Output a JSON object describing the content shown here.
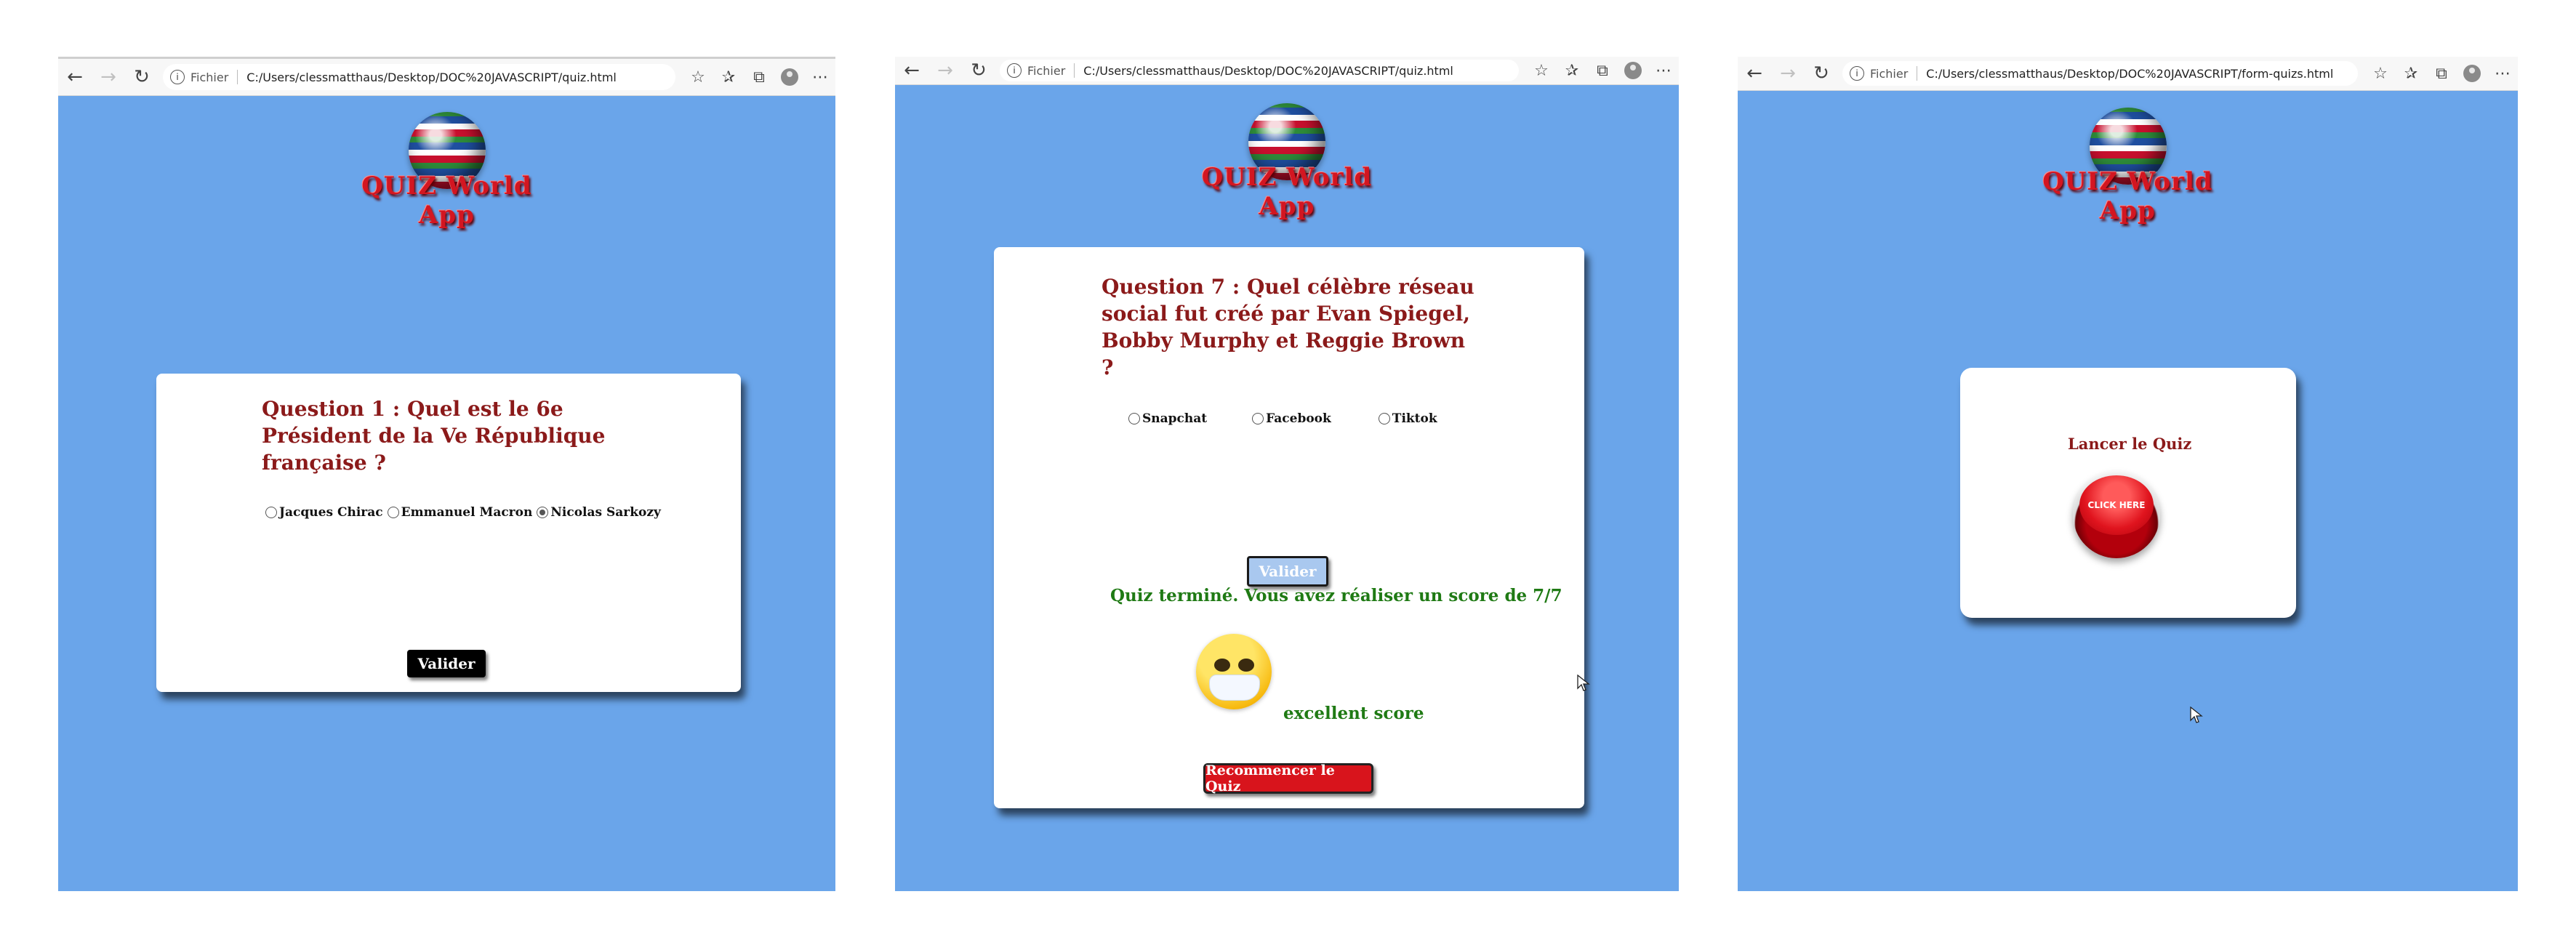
{
  "browser": {
    "file_label": "Fichier",
    "windows": [
      {
        "url": "C:/Users/clessmatthaus/Desktop/DOC%20JAVASCRIPT/quiz.html"
      },
      {
        "url": "C:/Users/clessmatthaus/Desktop/DOC%20JAVASCRIPT/quiz.html"
      },
      {
        "url": "C:/Users/clessmatthaus/Desktop/DOC%20JAVASCRIPT/form-quizs.html"
      }
    ]
  },
  "app": {
    "title": "QUIZ World App"
  },
  "screen1": {
    "question": "Question 1 : Quel est le 6e Président de la Ve République française ?",
    "options": [
      "Jacques Chirac",
      "Emmanuel Macron",
      "Nicolas Sarkozy"
    ],
    "selected_index": 2,
    "submit_label": "Valider"
  },
  "screen2": {
    "question": "Question 7 : Quel célèbre réseau social fut créé par Evan Spiegel, Bobby Murphy et Reggie Brown ?",
    "options": [
      "Snapchat",
      "Facebook",
      "Tiktok"
    ],
    "submit_label": "Valider",
    "result_text": "Quiz terminé. Vous avez réaliser un score de 7/7",
    "comment": "excellent score",
    "restart_label": "Recommencer le Quiz"
  },
  "screen3": {
    "launch_label": "Lancer le Quiz",
    "button_text": "CLICK HERE"
  },
  "colors": {
    "page_bg": "#6aa5ea",
    "title_red": "#d31621",
    "question_color": "#8b1a1a",
    "success_green": "#1f7a14"
  }
}
